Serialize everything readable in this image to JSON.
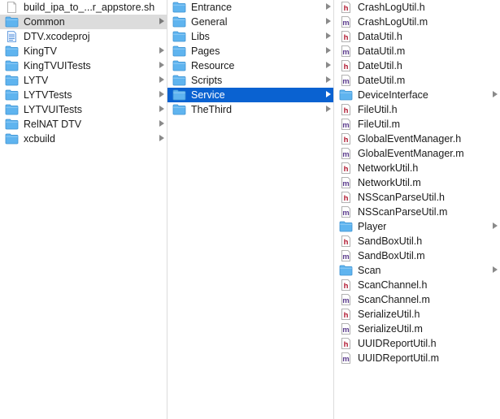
{
  "column1": {
    "items": [
      {
        "label": "build_ipa_to_...r_appstore.sh",
        "icon": "shell-script-file-icon",
        "chevron": false,
        "state": "none"
      },
      {
        "label": "Common",
        "icon": "folder-icon",
        "chevron": true,
        "state": "parent"
      },
      {
        "label": "DTV.xcodeproj",
        "icon": "xcodeproj-file-icon",
        "chevron": false,
        "state": "none"
      },
      {
        "label": "KingTV",
        "icon": "folder-icon",
        "chevron": true,
        "state": "none"
      },
      {
        "label": "KingTVUITests",
        "icon": "folder-icon",
        "chevron": true,
        "state": "none"
      },
      {
        "label": "LYTV",
        "icon": "folder-icon",
        "chevron": true,
        "state": "none"
      },
      {
        "label": "LYTVTests",
        "icon": "folder-icon",
        "chevron": true,
        "state": "none"
      },
      {
        "label": "LYTVUITests",
        "icon": "folder-icon",
        "chevron": true,
        "state": "none"
      },
      {
        "label": "RelNAT DTV",
        "icon": "folder-icon",
        "chevron": true,
        "state": "none"
      },
      {
        "label": "xcbuild",
        "icon": "folder-icon",
        "chevron": true,
        "state": "none"
      }
    ]
  },
  "column2": {
    "items": [
      {
        "label": "Entrance",
        "icon": "folder-icon",
        "chevron": true,
        "state": "none"
      },
      {
        "label": "General",
        "icon": "folder-icon",
        "chevron": true,
        "state": "none"
      },
      {
        "label": "Libs",
        "icon": "folder-icon",
        "chevron": true,
        "state": "none"
      },
      {
        "label": "Pages",
        "icon": "folder-icon",
        "chevron": true,
        "state": "none"
      },
      {
        "label": "Resource",
        "icon": "folder-icon",
        "chevron": true,
        "state": "none"
      },
      {
        "label": "Scripts",
        "icon": "folder-icon",
        "chevron": true,
        "state": "none"
      },
      {
        "label": "Service",
        "icon": "folder-icon",
        "chevron": true,
        "state": "active"
      },
      {
        "label": "TheThird",
        "icon": "folder-icon",
        "chevron": true,
        "state": "none"
      }
    ]
  },
  "column3": {
    "items": [
      {
        "label": "CrashLogUtil.h",
        "icon": "header-file-icon",
        "chevron": false,
        "state": "none"
      },
      {
        "label": "CrashLogUtil.m",
        "icon": "objc-source-file-icon",
        "chevron": false,
        "state": "none"
      },
      {
        "label": "DataUtil.h",
        "icon": "header-file-icon",
        "chevron": false,
        "state": "none"
      },
      {
        "label": "DataUtil.m",
        "icon": "objc-source-file-icon",
        "chevron": false,
        "state": "none"
      },
      {
        "label": "DateUtil.h",
        "icon": "header-file-icon",
        "chevron": false,
        "state": "none"
      },
      {
        "label": "DateUtil.m",
        "icon": "objc-source-file-icon",
        "chevron": false,
        "state": "none"
      },
      {
        "label": "DeviceInterface",
        "icon": "folder-icon",
        "chevron": true,
        "state": "none"
      },
      {
        "label": "FileUtil.h",
        "icon": "header-file-icon",
        "chevron": false,
        "state": "none"
      },
      {
        "label": "FileUtil.m",
        "icon": "objc-source-file-icon",
        "chevron": false,
        "state": "none"
      },
      {
        "label": "GlobalEventManager.h",
        "icon": "header-file-icon",
        "chevron": false,
        "state": "none"
      },
      {
        "label": "GlobalEventManager.m",
        "icon": "objc-source-file-icon",
        "chevron": false,
        "state": "none"
      },
      {
        "label": "NetworkUtil.h",
        "icon": "header-file-icon",
        "chevron": false,
        "state": "none"
      },
      {
        "label": "NetworkUtil.m",
        "icon": "objc-source-file-icon",
        "chevron": false,
        "state": "none"
      },
      {
        "label": "NSScanParseUtil.h",
        "icon": "header-file-icon",
        "chevron": false,
        "state": "none"
      },
      {
        "label": "NSScanParseUtil.m",
        "icon": "objc-source-file-icon",
        "chevron": false,
        "state": "none"
      },
      {
        "label": "Player",
        "icon": "folder-icon",
        "chevron": true,
        "state": "none"
      },
      {
        "label": "SandBoxUtil.h",
        "icon": "header-file-icon",
        "chevron": false,
        "state": "none"
      },
      {
        "label": "SandBoxUtil.m",
        "icon": "objc-source-file-icon",
        "chevron": false,
        "state": "none"
      },
      {
        "label": "Scan",
        "icon": "folder-icon",
        "chevron": true,
        "state": "none"
      },
      {
        "label": "ScanChannel.h",
        "icon": "header-file-icon",
        "chevron": false,
        "state": "none"
      },
      {
        "label": "ScanChannel.m",
        "icon": "objc-source-file-icon",
        "chevron": false,
        "state": "none"
      },
      {
        "label": "SerializeUtil.h",
        "icon": "header-file-icon",
        "chevron": false,
        "state": "none"
      },
      {
        "label": "SerializeUtil.m",
        "icon": "objc-source-file-icon",
        "chevron": false,
        "state": "none"
      },
      {
        "label": "UUIDReportUtil.h",
        "icon": "header-file-icon",
        "chevron": false,
        "state": "none"
      },
      {
        "label": "UUIDReportUtil.m",
        "icon": "objc-source-file-icon",
        "chevron": false,
        "state": "none"
      }
    ]
  },
  "colors": {
    "active_selection": "#0a62d1",
    "parent_selection": "#dcdcdc",
    "folder_blue": "#5fb4ef",
    "header_h": "#b0162e",
    "source_m": "#5b3b8c"
  }
}
